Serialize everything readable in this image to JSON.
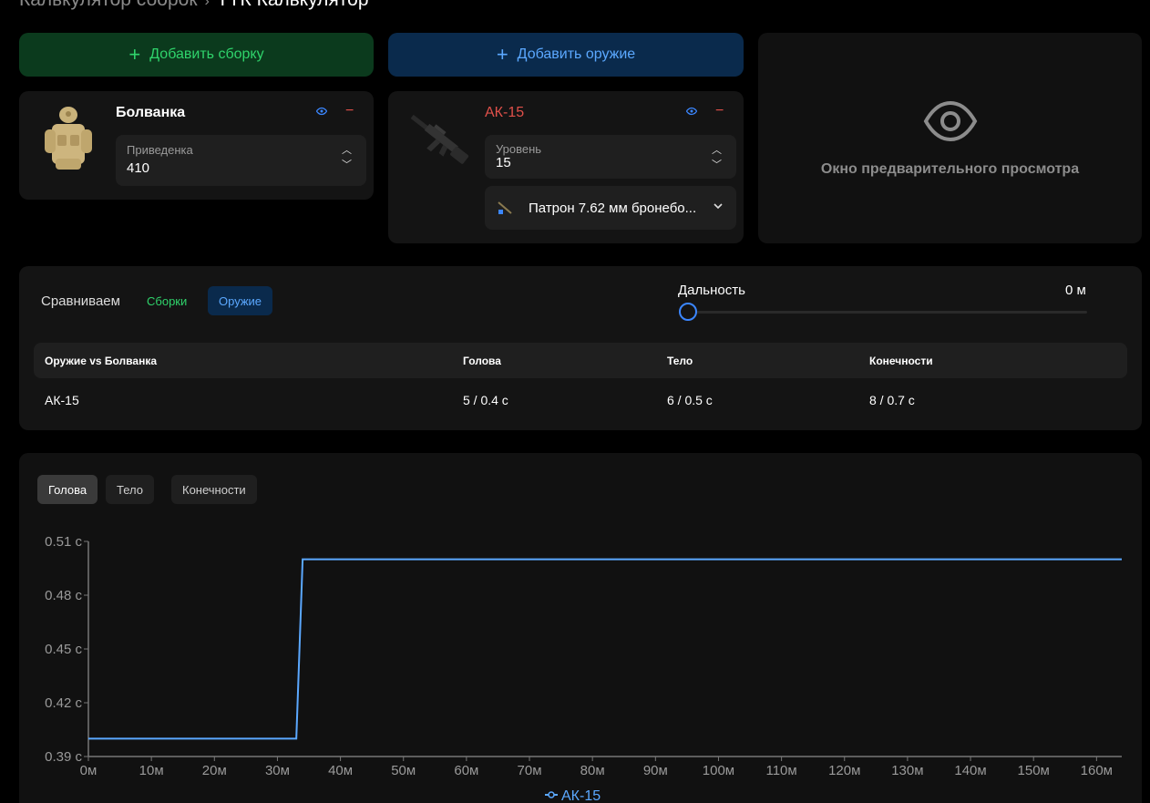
{
  "breadcrumb": {
    "parent": "Калькулятор сборок",
    "separator": "›",
    "current": "ТТК Калькулятор"
  },
  "actions": {
    "add_build": "Добавить сборку",
    "add_weapon": "Добавить оружие"
  },
  "build": {
    "name": "Болванка",
    "field_label": "Приведенка",
    "field_value": "410"
  },
  "weapon": {
    "name": "АК-15",
    "level_label": "Уровень",
    "level_value": "15",
    "ammo": "Патрон 7.62 мм бронебо..."
  },
  "preview": {
    "text": "Окно предварительного просмотра"
  },
  "compare": {
    "label": "Сравниваем",
    "toggle_builds": "Сборки",
    "toggle_weapons": "Оружие",
    "range_label": "Дальность",
    "range_value": "0 м",
    "range_fraction": 0
  },
  "table": {
    "headers": [
      "Оружие vs Болванка",
      "Голова",
      "Тело",
      "Конечности"
    ],
    "rows": [
      [
        "АК-15",
        "5 / 0.4 с",
        "6 / 0.5 с",
        "8 / 0.7 с"
      ]
    ]
  },
  "chart_tabs": [
    "Голова",
    "Тело",
    "Конечности"
  ],
  "colors": {
    "accent_blue": "#5ba8ff",
    "accent_green": "#2fd36b",
    "danger_red": "#e0504a"
  },
  "chart_data": {
    "type": "line",
    "x_ticks": [
      "0м",
      "10м",
      "20м",
      "30м",
      "40м",
      "50м",
      "60м",
      "70м",
      "80м",
      "90м",
      "100м",
      "110м",
      "120м",
      "130м",
      "140м",
      "150м",
      "160м"
    ],
    "y_ticks": [
      "0.39 с",
      "0.42 с",
      "0.45 с",
      "0.48 с",
      "0.51 с"
    ],
    "xlim": [
      0,
      164
    ],
    "ylim": [
      0.39,
      0.51
    ],
    "series": [
      {
        "name": "АК-15",
        "x": [
          0,
          33,
          34,
          164
        ],
        "y": [
          0.4,
          0.4,
          0.5,
          0.5
        ]
      }
    ],
    "legend": "bottom-center",
    "grid": false
  }
}
